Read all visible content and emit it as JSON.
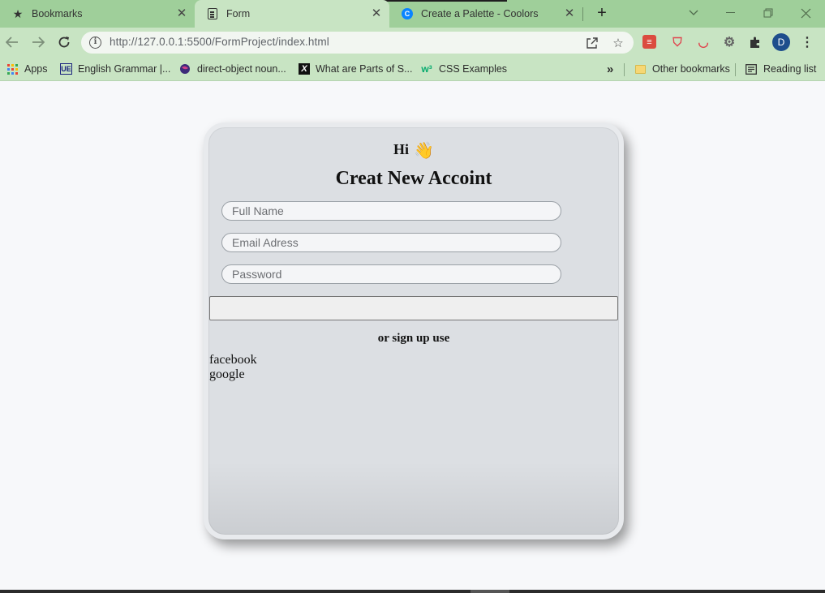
{
  "browser": {
    "tabs": [
      {
        "label": "Bookmarks",
        "icon": "star-icon"
      },
      {
        "label": "Form",
        "icon": "document-icon",
        "active": true
      },
      {
        "label": "Create a Palette - Coolors",
        "icon": "coolors-icon"
      }
    ],
    "url": "http://127.0.0.1:5500/FormProject/index.html",
    "avatar_letter": "D",
    "bookmarks": [
      {
        "label": "Apps",
        "icon": "apps-grid-icon"
      },
      {
        "label": "English Grammar |...",
        "icon": "ue-icon"
      },
      {
        "label": "direct-object noun...",
        "icon": "globe-icon"
      },
      {
        "label": "What are Parts of S...",
        "icon": "x-icon"
      },
      {
        "label": "CSS Examples",
        "icon": "w3-icon"
      }
    ],
    "more_bookmarks": "»",
    "other_bookmarks": "Other bookmarks",
    "reading_list": "Reading list"
  },
  "form": {
    "greeting": "Hi",
    "greeting_emoji": "👋",
    "title": "Creat New Accoint",
    "fullname_placeholder": "Full Name",
    "email_placeholder": "Email Adress",
    "password_placeholder": "Password",
    "submit_label": "",
    "alt_text": "or sign up use",
    "social": [
      "facebook",
      "google"
    ]
  },
  "colors": {
    "tab_strip": "#9fcf9a",
    "toolbar": "#c8e4c3",
    "card": "#dcdfe3",
    "page": "#f7f8fa"
  }
}
